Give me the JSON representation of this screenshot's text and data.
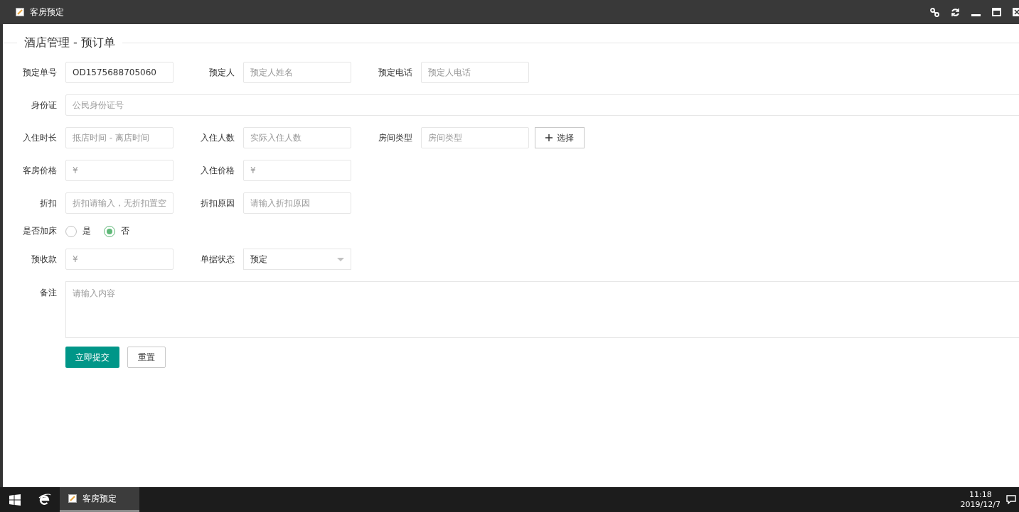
{
  "window": {
    "title": "客房预定"
  },
  "panel": {
    "legend": "酒店管理 - 预订单"
  },
  "form": {
    "rows": [
      {
        "fields": [
          {
            "kind": "input",
            "label": "预定单号",
            "value": "OD1575688705060"
          },
          {
            "kind": "input",
            "label": "预定人",
            "placeholder": "预定人姓名"
          },
          {
            "kind": "input",
            "label": "预定电话",
            "placeholder": "预定人电话"
          }
        ]
      },
      {
        "fields": [
          {
            "kind": "full",
            "label": "身份证",
            "placeholder": "公民身份证号"
          }
        ]
      },
      {
        "fields": [
          {
            "kind": "input",
            "label": "入住时长",
            "placeholder": "抵店时间 - 离店时间"
          },
          {
            "kind": "input",
            "label": "入住人数",
            "placeholder": "实际入住人数"
          },
          {
            "kind": "input",
            "label": "房间类型",
            "placeholder": "房间类型",
            "button": "选择"
          }
        ]
      },
      {
        "fields": [
          {
            "kind": "input",
            "label": "客房价格",
            "placeholder": "¥"
          },
          {
            "kind": "input",
            "label": "入住价格",
            "placeholder": "¥"
          }
        ]
      },
      {
        "fields": [
          {
            "kind": "input",
            "label": "折扣",
            "placeholder": "折扣请输入，无折扣置空"
          },
          {
            "kind": "input",
            "label": "折扣原因",
            "placeholder": "请输入折扣原因"
          }
        ]
      },
      {
        "fields": [
          {
            "kind": "radio",
            "label": "是否加床",
            "options": [
              {
                "label": "是",
                "selected": false
              },
              {
                "label": "否",
                "selected": true
              }
            ]
          }
        ]
      },
      {
        "fields": [
          {
            "kind": "input",
            "label": "预收款",
            "placeholder": "¥"
          },
          {
            "kind": "select",
            "label": "单据状态",
            "value": "预定"
          }
        ]
      },
      {
        "fields": [
          {
            "kind": "textarea",
            "label": "备注",
            "placeholder": "请输入内容"
          }
        ]
      }
    ],
    "buttons": [
      {
        "kind": "primary",
        "label": "立即提交"
      },
      {
        "kind": "default",
        "label": "重置"
      }
    ]
  },
  "taskbar": {
    "task": "客房预定",
    "time": "11:18",
    "date": "2019/12/7"
  }
}
